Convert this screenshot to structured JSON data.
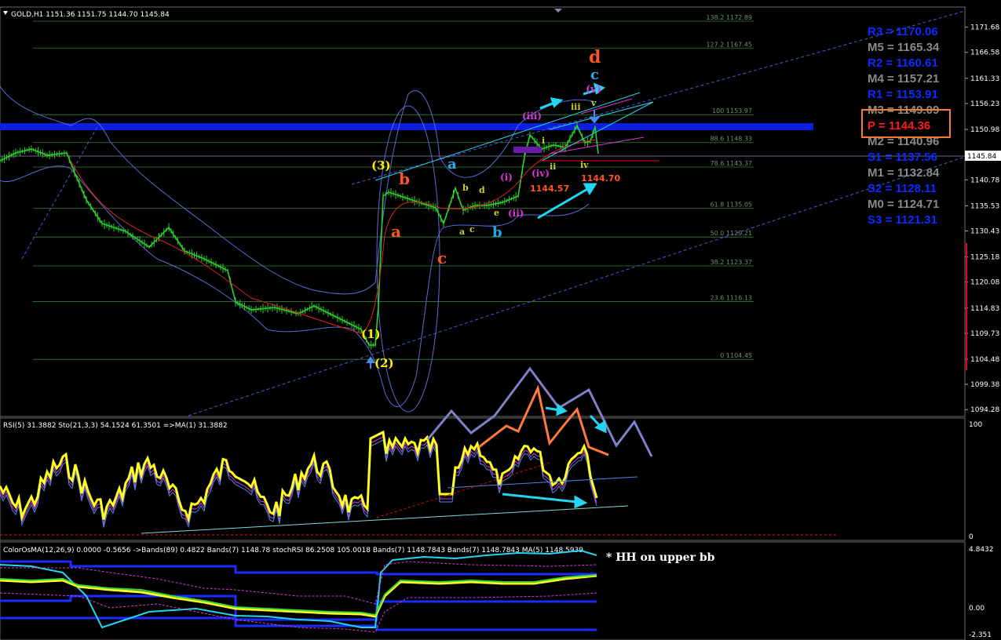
{
  "chart_data": {
    "type": "candlestick",
    "symbol_header": "GOLD,H1  1151.36 1151.75 1144.70 1145.84",
    "price_axis": {
      "ylim": [
        1094.28,
        1175.5
      ],
      "ticks": [
        "1171.68",
        "1166.58",
        "1161.33",
        "1156.23",
        "1150.98",
        "1145.84",
        "1140.78",
        "1135.53",
        "1130.43",
        "1125.18",
        "1120.08",
        "1114.83",
        "1109.73",
        "1104.48",
        "1099.38",
        "1094.28"
      ],
      "current_price": "1145.84"
    },
    "fib_levels": [
      {
        "label": "138.2 1172.89",
        "value": 1172.89
      },
      {
        "label": "127.2 1167.45",
        "value": 1167.45
      },
      {
        "label": "100 1153.97",
        "value": 1153.97
      },
      {
        "label": "88.6 1148.33",
        "value": 1148.33
      },
      {
        "label": "78.6 1143.37",
        "value": 1143.37
      },
      {
        "label": "61.8 1135.05",
        "value": 1135.05
      },
      {
        "label": "50.0 1129.21",
        "value": 1129.21
      },
      {
        "label": "38.2 1123.37",
        "value": 1123.37
      },
      {
        "label": "23.6 1116.13",
        "value": 1116.13
      },
      {
        "label": "0 1104.45",
        "value": 1104.45
      }
    ],
    "pivots": [
      {
        "label": "R3 = 1170.06",
        "color": "#0a2cff"
      },
      {
        "label": "M5 = 1165.34",
        "color": "#8a8a8a"
      },
      {
        "label": "R2 = 1160.61",
        "color": "#0a2cff"
      },
      {
        "label": "M4 = 1157.21",
        "color": "#8a8a8a"
      },
      {
        "label": "R1 = 1153.91",
        "color": "#0a2cff"
      },
      {
        "label": "M3 = 1149.09",
        "color": "#8a8a8a"
      },
      {
        "label": "P  = 1144.36",
        "color": "#ff1a1a"
      },
      {
        "label": "M2 = 1140.96",
        "color": "#8a8a8a"
      },
      {
        "label": "S1 = 1137.56",
        "color": "#0a2cff"
      },
      {
        "label": "M1 = 1132.84",
        "color": "#8a8a8a"
      },
      {
        "label": "S2 = 1128.11",
        "color": "#0a2cff"
      },
      {
        "label": "M0 = 1124.71",
        "color": "#8a8a8a"
      },
      {
        "label": "S3 = 1121.31",
        "color": "#0a2cff"
      }
    ],
    "wave_labels": {
      "d": "d",
      "c_blue_top": "c",
      "v_paren": "(v)",
      "iii_paren": "(iii)",
      "iii": "iii",
      "v": "v",
      "i": "i",
      "ii": "ii",
      "iv": "iv",
      "iv_paren": "(iv)",
      "i_paren": "(i)",
      "ii_paren": "(ii)",
      "three_paren": "(3)",
      "one_paren": "(1)",
      "two_paren": "(2)",
      "b_red": "b",
      "a_red": "a",
      "c_red": "c",
      "a_blue": "a",
      "b_blue": "b",
      "a_small": "a",
      "b_small": "b",
      "c_small": "c",
      "d_small": "d",
      "e_small": "e",
      "price_1144_57": "1144.57",
      "price_1144_70": "1144.70"
    },
    "rsi_panel": {
      "header": "RSI(5) 31.3882  Sto(21,3,3) 54.1524 61.3501  =>MA(1) 31.3882",
      "ticks": [
        "100",
        "0"
      ]
    },
    "osma_panel": {
      "header": "ColorOsMA(12,26,9) 0.0000 -0.5656  ->Bands(89) 0.4822  Bands(7) 1148.78  stochRSI 86.2508 105.0018  Bands(7) 1148.7843  Bands(7) 1148.7843  MA(5) 1148.5939",
      "ticks": [
        "4.8432",
        "0.00",
        "-2.351"
      ],
      "note": "* HH on upper bb"
    },
    "colors": {
      "background": "#000000",
      "candle": "#2bd12b",
      "pivot_band": "#0a1fe0",
      "bb": "#5a6bd8",
      "rsi": "#ffff22",
      "annotation_cyan": "#22d6f2",
      "annotation_orange": "#ff7a3a",
      "annotation_purple": "#8080c8",
      "pivot_box": "#ff7a30"
    }
  }
}
